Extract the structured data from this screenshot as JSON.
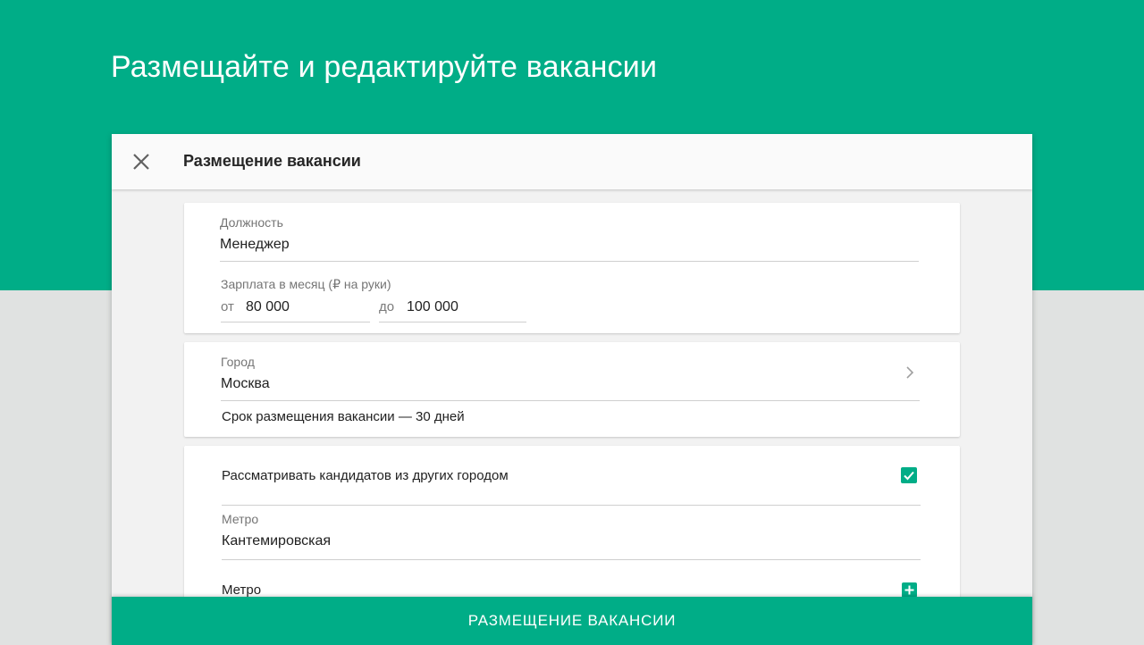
{
  "page": {
    "title": "Размещайте и редактируйте вакансии"
  },
  "dialog": {
    "title": "Размещение вакансии",
    "close_icon": "close-icon"
  },
  "position_card": {
    "position_label": "Должность",
    "position_value": "Менеджер",
    "salary_label": "Зарплата в месяц (₽ на руки)",
    "salary_from_prefix": "от",
    "salary_from_value": "80 000",
    "salary_to_prefix": "до",
    "salary_to_value": "100 000"
  },
  "city_card": {
    "city_label": "Город",
    "city_value": "Москва",
    "chevron_icon": "chevron-right-icon",
    "duration_text": "Срок размещения вакансии — 30 дней"
  },
  "location_card": {
    "other_cities_label": "Рассматривать кандидатов из других городом",
    "other_cities_checked": true,
    "metro_label": "Метро",
    "metro_value": "Кантемировская",
    "metro_add_label": "Метро",
    "add_icon": "plus-icon"
  },
  "footer": {
    "submit_label": "РАЗМЕЩЕНИЕ ВАКАНСИИ"
  },
  "colors": {
    "brand": "#00ad87",
    "background": "#e0e2e1",
    "dialog_background": "#f2f2f2"
  }
}
